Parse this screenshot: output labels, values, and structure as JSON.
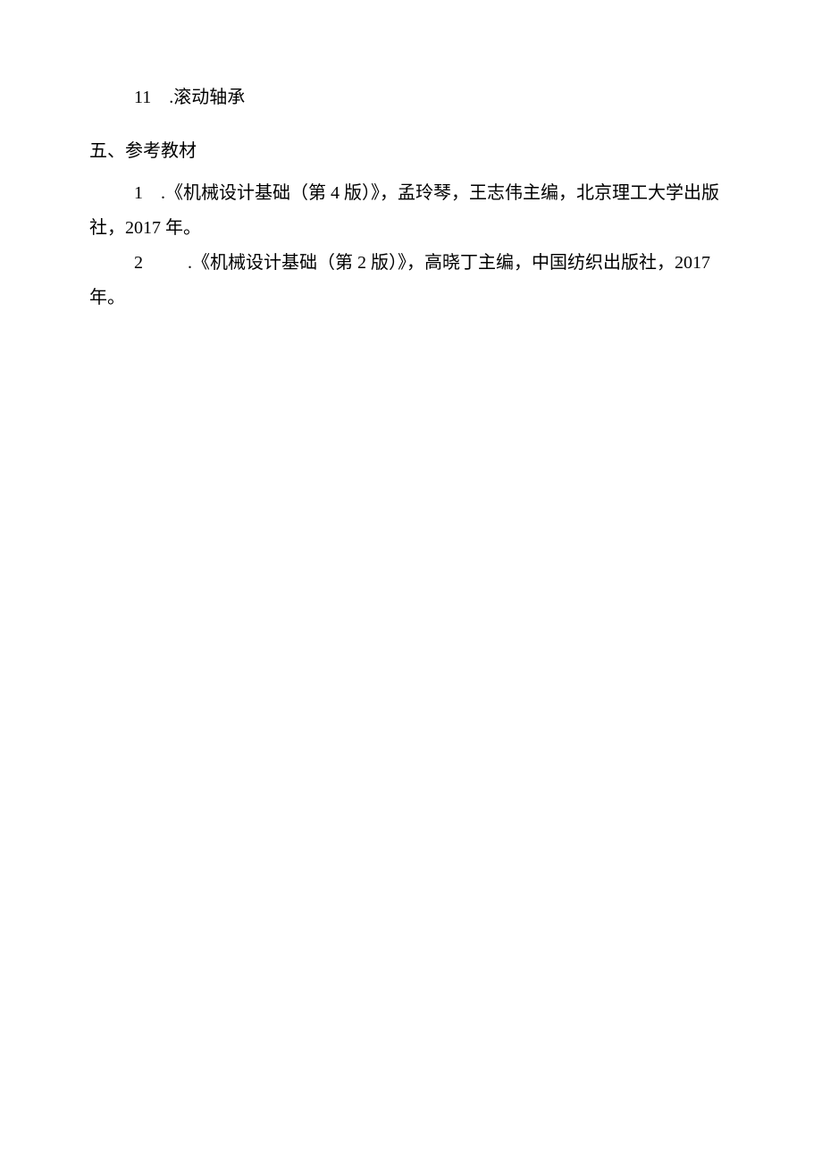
{
  "list_item": {
    "number": "11",
    "text": ".滚动轴承"
  },
  "section": {
    "number": "五、",
    "title": "参考教材"
  },
  "references": [
    {
      "number": "1",
      "line1": ".《机械设计基础（第 4 版）》，孟玲琴，王志伟主编，北京理工大学出版",
      "line2": "社，2017 年。"
    },
    {
      "number": "2",
      "line1": ".《机械设计基础（第 2 版）》，高晓丁主编，中国纺织出版社，2017",
      "line2": "年。"
    }
  ]
}
